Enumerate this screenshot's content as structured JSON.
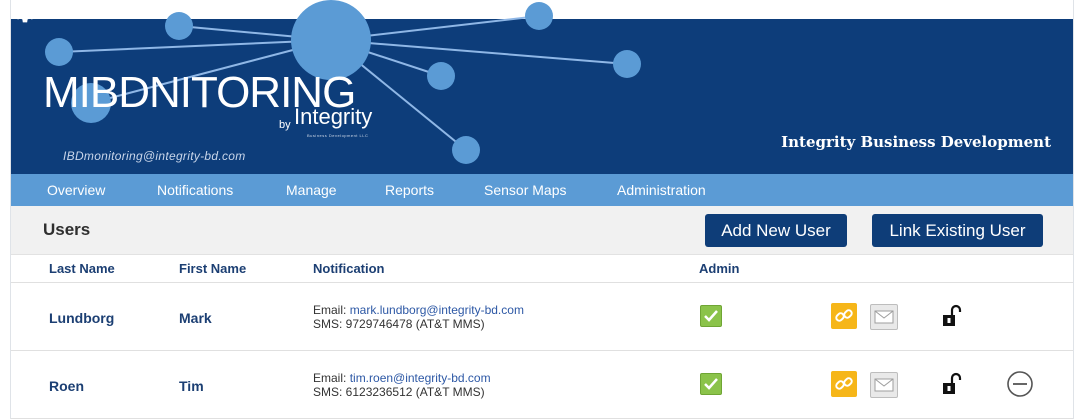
{
  "banner": {
    "brand": "MIBDNITORING",
    "by": "by",
    "integrity": "Integrity",
    "integrity_sub": "Business Development LLC",
    "email": "IBDmonitoring@integrity-bd.com",
    "company": "Integrity Business Development",
    "settings_icon": "gear-icon"
  },
  "nav": {
    "items": [
      {
        "label": "Overview"
      },
      {
        "label": "Notifications"
      },
      {
        "label": "Manage"
      },
      {
        "label": "Reports"
      },
      {
        "label": "Sensor Maps"
      },
      {
        "label": "Administration"
      }
    ]
  },
  "section": {
    "title": "Users",
    "add_button": "Add New User",
    "link_button": "Link Existing User"
  },
  "table": {
    "headers": {
      "last": "Last Name",
      "first": "First Name",
      "notification": "Notification",
      "admin": "Admin"
    },
    "rows": [
      {
        "last": "Lundborg",
        "first": "Mark",
        "email_label": "Email: ",
        "email": "mark.lundborg@integrity-bd.com",
        "sms": "SMS: 9729746478 (AT&T MMS)",
        "admin": true,
        "removable": false
      },
      {
        "last": "Roen",
        "first": "Tim",
        "email_label": "Email: ",
        "email": "tim.roen@integrity-bd.com",
        "sms": "SMS: 6123236512 (AT&T MMS)",
        "admin": true,
        "removable": true
      }
    ]
  },
  "colors": {
    "banner": "#0d3d7a",
    "nav": "#5b9bd5",
    "button": "#0e3d78",
    "accent_text": "#1c3f73"
  }
}
